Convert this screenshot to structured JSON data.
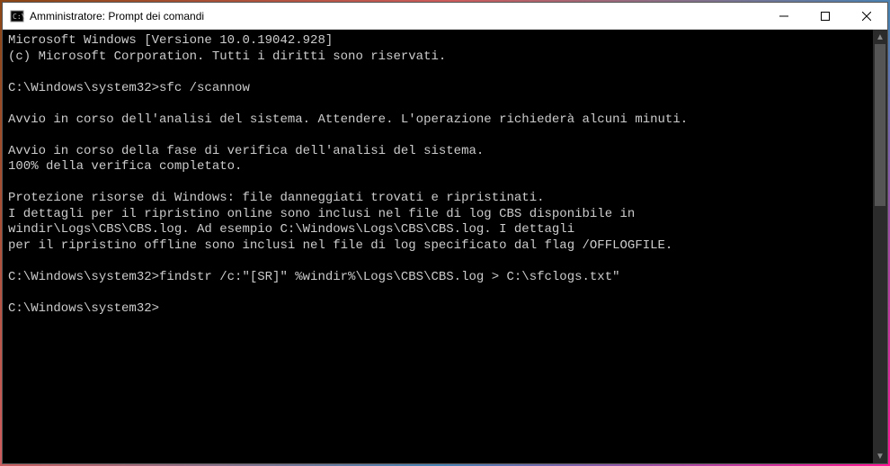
{
  "window": {
    "title": "Amministratore: Prompt dei comandi"
  },
  "terminal": {
    "lines": [
      "Microsoft Windows [Versione 10.0.19042.928]",
      "(c) Microsoft Corporation. Tutti i diritti sono riservati.",
      "",
      "C:\\Windows\\system32>sfc /scannow",
      "",
      "Avvio in corso dell'analisi del sistema. Attendere. L'operazione richiederà alcuni minuti.",
      "",
      "Avvio in corso della fase di verifica dell'analisi del sistema.",
      "100% della verifica completato.",
      "",
      "Protezione risorse di Windows: file danneggiati trovati e ripristinati.",
      "I dettagli per il ripristino online sono inclusi nel file di log CBS disponibile in",
      "windir\\Logs\\CBS\\CBS.log. Ad esempio C:\\Windows\\Logs\\CBS\\CBS.log. I dettagli",
      "per il ripristino offline sono inclusi nel file di log specificato dal flag /OFFLOGFILE.",
      "",
      "C:\\Windows\\system32>findstr /c:\"[SR]\" %windir%\\Logs\\CBS\\CBS.log > C:\\sfclogs.txt\"",
      "",
      "C:\\Windows\\system32>"
    ]
  }
}
